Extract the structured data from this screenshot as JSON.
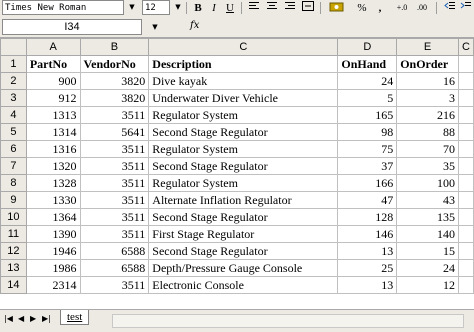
{
  "toolbar": {
    "font_name": "Times New Roman",
    "font_size": "12",
    "bold_label": "B",
    "italic_label": "I",
    "underline_label": "U",
    "percent_label": "%",
    "comma_label": ","
  },
  "formula_bar": {
    "name_box": "I34",
    "fx_label": "fx",
    "formula_value": ""
  },
  "columns": [
    "A",
    "B",
    "C",
    "D",
    "E",
    "C"
  ],
  "rows": [
    {
      "num": "1",
      "cells": [
        "PartNo",
        "VendorNo",
        "Description",
        "OnHand",
        "OnOrder",
        ""
      ]
    },
    {
      "num": "2",
      "cells": [
        "900",
        "3820",
        "Dive kayak",
        "24",
        "16",
        ""
      ]
    },
    {
      "num": "3",
      "cells": [
        "912",
        "3820",
        "Underwater Diver Vehicle",
        "5",
        "3",
        ""
      ]
    },
    {
      "num": "4",
      "cells": [
        "1313",
        "3511",
        "Regulator System",
        "165",
        "216",
        ""
      ]
    },
    {
      "num": "5",
      "cells": [
        "1314",
        "5641",
        "Second Stage Regulator",
        "98",
        "88",
        ""
      ]
    },
    {
      "num": "6",
      "cells": [
        "1316",
        "3511",
        "Regulator System",
        "75",
        "70",
        ""
      ]
    },
    {
      "num": "7",
      "cells": [
        "1320",
        "3511",
        "Second Stage Regulator",
        "37",
        "35",
        ""
      ]
    },
    {
      "num": "8",
      "cells": [
        "1328",
        "3511",
        "Regulator System",
        "166",
        "100",
        ""
      ]
    },
    {
      "num": "9",
      "cells": [
        "1330",
        "3511",
        "Alternate Inflation Regulator",
        "47",
        "43",
        ""
      ]
    },
    {
      "num": "10",
      "cells": [
        "1364",
        "3511",
        "Second Stage Regulator",
        "128",
        "135",
        ""
      ]
    },
    {
      "num": "11",
      "cells": [
        "1390",
        "3511",
        "First Stage Regulator",
        "146",
        "140",
        ""
      ]
    },
    {
      "num": "12",
      "cells": [
        "1946",
        "6588",
        "Second Stage Regulator",
        "13",
        "15",
        ""
      ]
    },
    {
      "num": "13",
      "cells": [
        "1986",
        "6588",
        "Depth/Pressure Gauge Console",
        "25",
        "24",
        ""
      ]
    },
    {
      "num": "14",
      "cells": [
        "2314",
        "3511",
        "Electronic Console",
        "13",
        "12",
        ""
      ]
    }
  ],
  "sheet_tabs": [
    {
      "label": "test"
    }
  ],
  "nav_icons": [
    "first-sheet-icon",
    "prev-sheet-icon",
    "next-sheet-icon",
    "last-sheet-icon"
  ]
}
